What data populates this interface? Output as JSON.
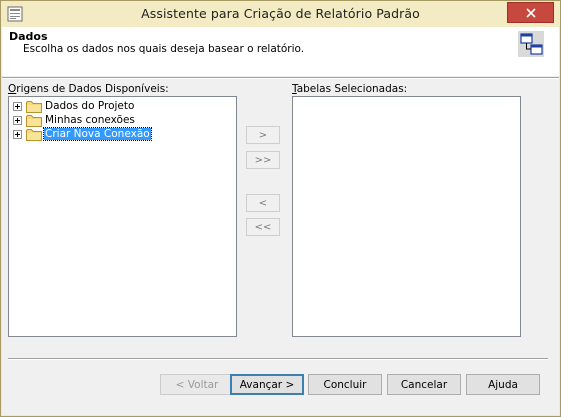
{
  "window": {
    "title": "Assistente para Criação de Relatório Padrão"
  },
  "header": {
    "title": "Dados",
    "subtitle": "Escolha os dados nos quais deseja basear o relatório."
  },
  "left_panel": {
    "label_prefix": "",
    "label_accel": "O",
    "label_rest": "rigens de Dados Disponíveis:",
    "items": [
      {
        "label": "Dados do Projeto",
        "icon": "folder-icon",
        "selected": false
      },
      {
        "label": "Minhas conexões",
        "icon": "folder-icon",
        "selected": false
      },
      {
        "label": "Criar Nova Conexão",
        "icon": "folder-icon",
        "selected": true
      }
    ]
  },
  "right_panel": {
    "label_accel": "T",
    "label_rest": "abelas Selecionadas:",
    "items": []
  },
  "transfer_buttons": {
    "add": ">",
    "add_all": ">>",
    "remove": "<",
    "remove_all": "<<"
  },
  "nav_buttons": {
    "back": "< Voltar",
    "next": "Avançar >",
    "finish": "Concluir",
    "cancel": "Cancelar",
    "help": "Ajuda"
  },
  "colors": {
    "titlebar": "#f3ebc3",
    "close": "#c7483f",
    "selection": "#3399ff"
  }
}
